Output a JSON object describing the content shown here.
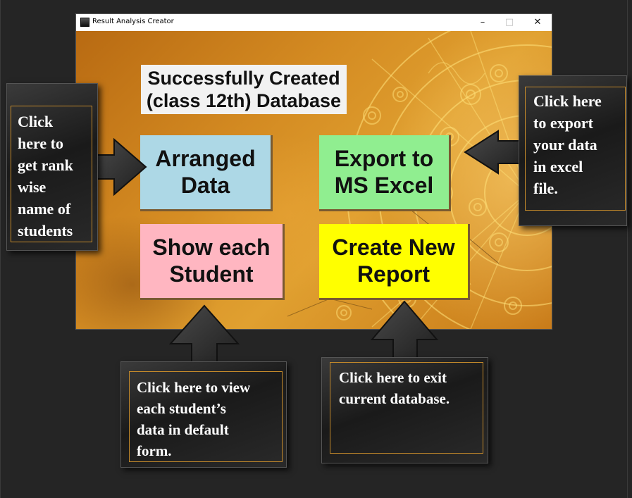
{
  "window": {
    "title": "Result Analysis Creator",
    "minimize_glyph": "–",
    "maximize_glyph": "□",
    "close_glyph": "✕"
  },
  "main": {
    "heading_line1": "Successfully Created",
    "heading_line2": "(class 12th) Database",
    "buttons": {
      "arranged_line1": "Arranged",
      "arranged_line2": "Data",
      "export_line1": "Export to",
      "export_line2": "MS Excel",
      "show_line1": "Show each",
      "show_line2": "Student",
      "create_line1": "Create New",
      "create_line2": "Report"
    }
  },
  "callouts": {
    "left": [
      "Click",
      "here to",
      "get rank",
      "wise",
      "name of",
      "students"
    ],
    "right": [
      "Click here",
      "to export",
      "your data",
      "in excel",
      "file."
    ],
    "bottom_left": [
      "Click here to view",
      "each student’s",
      "data in default",
      "form."
    ],
    "bottom_right": [
      "Click here to exit",
      "current database."
    ]
  },
  "colors": {
    "arranged": "#add8e6",
    "export": "#90ee90",
    "show": "#ffb6c1",
    "create": "#ffff00",
    "callout_border": "#c58a2a"
  }
}
